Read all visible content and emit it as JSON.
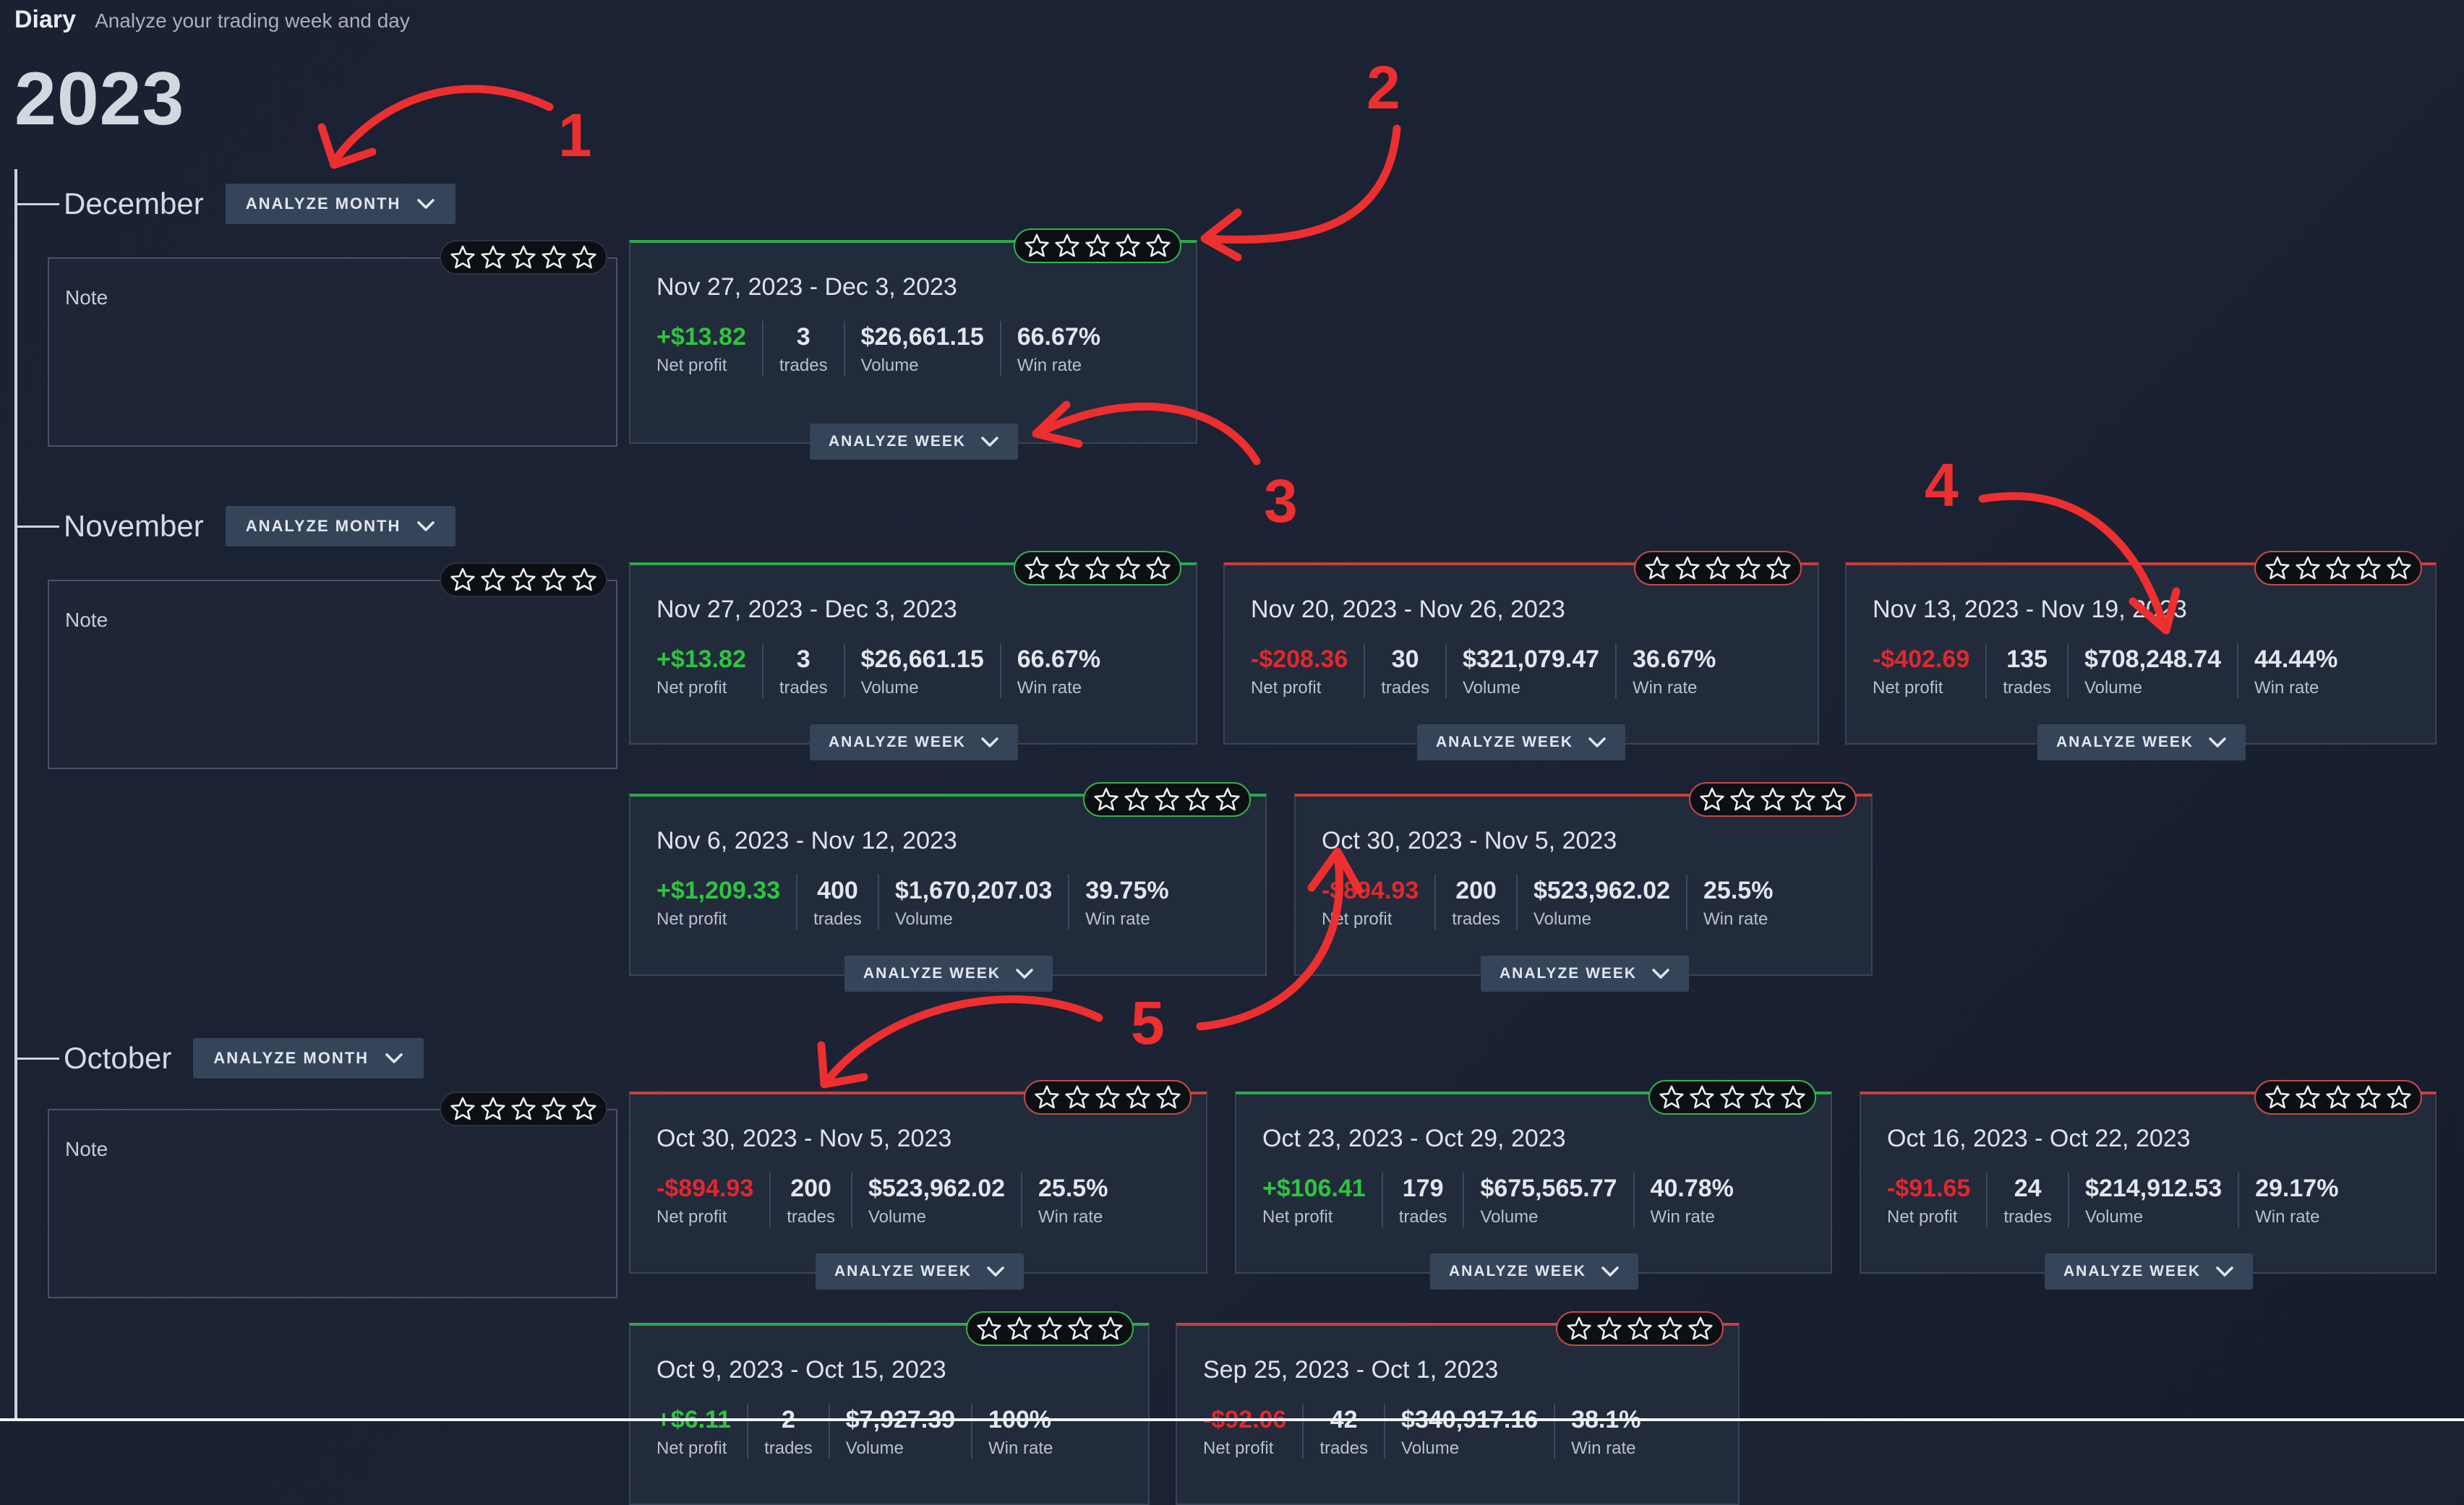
{
  "header": {
    "title": "Diary",
    "subtitle": "Analyze your trading week and day"
  },
  "year": "2023",
  "analyze_month_label": "ANALYZE MONTH",
  "analyze_week_label": "ANALYZE WEEK",
  "note_label": "Note",
  "stat_labels": {
    "net_profit": "Net profit",
    "trades": "trades",
    "volume": "Volume",
    "win_rate": "Win rate"
  },
  "months": [
    {
      "name": "December",
      "weeks": [
        {
          "range": "Nov 27, 2023 - Dec 3, 2023",
          "net_profit": "+$13.82",
          "trades": "3",
          "volume": "$26,661.15",
          "win_rate": "66.67%",
          "outcome": "positive"
        }
      ]
    },
    {
      "name": "November",
      "weeks": [
        {
          "range": "Nov 27, 2023 - Dec 3, 2023",
          "net_profit": "+$13.82",
          "trades": "3",
          "volume": "$26,661.15",
          "win_rate": "66.67%",
          "outcome": "positive"
        },
        {
          "range": "Nov 20, 2023 - Nov 26, 2023",
          "net_profit": "-$208.36",
          "trades": "30",
          "volume": "$321,079.47",
          "win_rate": "36.67%",
          "outcome": "negative"
        },
        {
          "range": "Nov 13, 2023 - Nov 19, 2023",
          "net_profit": "-$402.69",
          "trades": "135",
          "volume": "$708,248.74",
          "win_rate": "44.44%",
          "outcome": "negative"
        },
        {
          "range": "Nov 6, 2023 - Nov 12, 2023",
          "net_profit": "+$1,209.33",
          "trades": "400",
          "volume": "$1,670,207.03",
          "win_rate": "39.75%",
          "outcome": "positive"
        },
        {
          "range": "Oct 30, 2023 - Nov 5, 2023",
          "net_profit": "-$894.93",
          "trades": "200",
          "volume": "$523,962.02",
          "win_rate": "25.5%",
          "outcome": "negative"
        }
      ]
    },
    {
      "name": "October",
      "weeks": [
        {
          "range": "Oct 30, 2023 - Nov 5, 2023",
          "net_profit": "-$894.93",
          "trades": "200",
          "volume": "$523,962.02",
          "win_rate": "25.5%",
          "outcome": "negative"
        },
        {
          "range": "Oct 23, 2023 - Oct 29, 2023",
          "net_profit": "+$106.41",
          "trades": "179",
          "volume": "$675,565.77",
          "win_rate": "40.78%",
          "outcome": "positive"
        },
        {
          "range": "Oct 16, 2023 - Oct 22, 2023",
          "net_profit": "-$91.65",
          "trades": "24",
          "volume": "$214,912.53",
          "win_rate": "29.17%",
          "outcome": "negative"
        },
        {
          "range": "Oct 9, 2023 - Oct 15, 2023",
          "net_profit": "+$6.11",
          "trades": "2",
          "volume": "$7,927.39",
          "win_rate": "100%",
          "outcome": "positive"
        },
        {
          "range": "Sep 25, 2023 - Oct 1, 2023",
          "net_profit": "-$92.06",
          "trades": "42",
          "volume": "$340,917.16",
          "win_rate": "38.1%",
          "outcome": "negative"
        }
      ]
    }
  ],
  "rating": {
    "max_stars": 5,
    "value": 0
  },
  "icons": {
    "star": "star-outline-icon",
    "chevron": "chevron-down-icon"
  },
  "annotations": [
    "1",
    "2",
    "3",
    "4",
    "5"
  ],
  "colors": {
    "positive": "#2ec53f",
    "negative": "#e0282e",
    "annotation": "#ee2f2f",
    "button_bg": "#36445a"
  }
}
